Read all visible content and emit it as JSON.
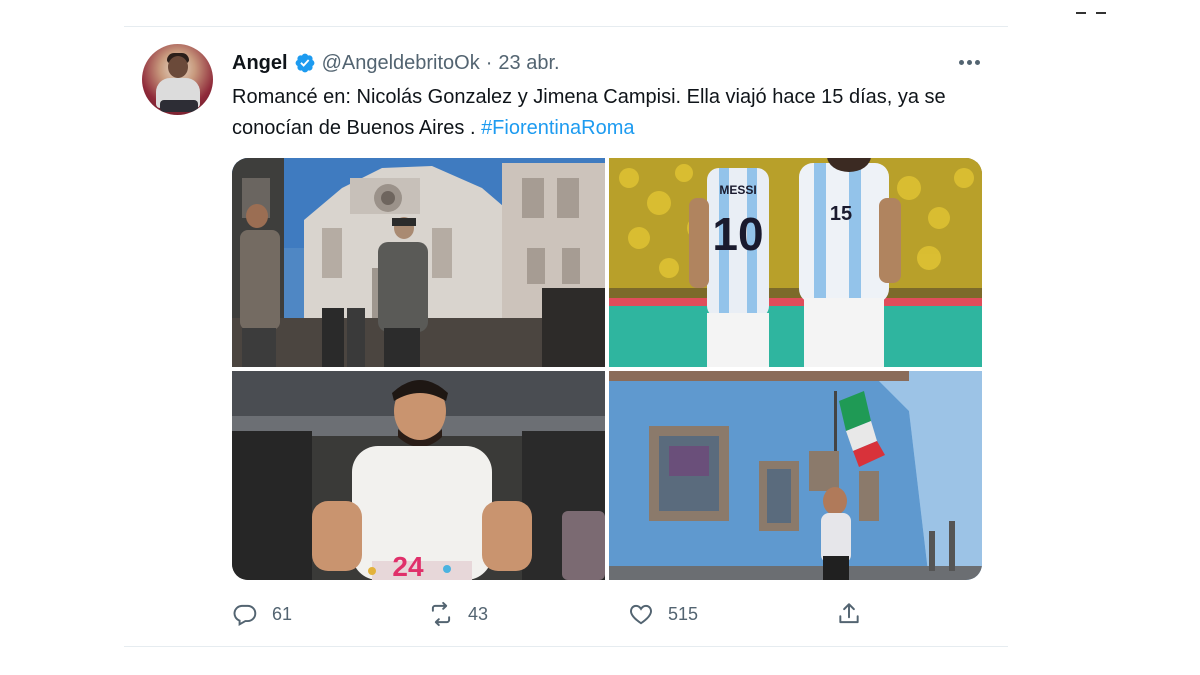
{
  "tweet": {
    "author": {
      "name": "Angel",
      "handle": "@AngeldebritoOk",
      "separator": "·",
      "date": "23 abr.",
      "verified": true
    },
    "text_main": "Romancé en: Nicolás Gonzalez y Jimena Campisi. Ella viajó hace 15 días, ya se conocían de Buenos Aires . ",
    "hashtag": "#FiorentinaRoma",
    "media": {
      "photo_1": {
        "icon": "cathedral-photo"
      },
      "photo_2": {
        "icon": "football-players-photo",
        "jersey_names": [
          "MESSI"
        ],
        "jersey_numbers": [
          "10",
          "15"
        ]
      },
      "photo_3": {
        "icon": "birthday-photo",
        "candle_text": "24"
      },
      "photo_4": {
        "icon": "blue-building-photo"
      }
    },
    "actions": {
      "replies": "61",
      "retweets": "43",
      "likes": "515"
    }
  },
  "colors": {
    "accent": "#1d9bf0",
    "text": "#0f1419",
    "muted": "#536471"
  }
}
